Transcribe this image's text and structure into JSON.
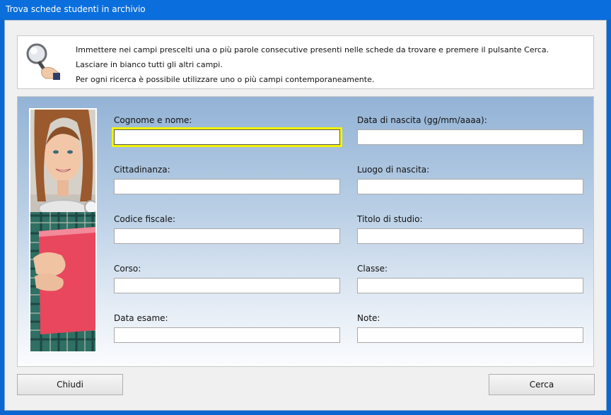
{
  "window": {
    "title": "Trova schede studenti in archivio"
  },
  "info": {
    "icon": "magnifier-icon",
    "lines": [
      "Immettere nei campi prescelti una o più parole consecutive presenti nelle schede da trovare e premere il pulsante Cerca.",
      "Lasciare in bianco tutti gli altri campi.",
      "Per ogni ricerca è possibile utilizzare uno o più campi contemporaneamente."
    ]
  },
  "form": {
    "fields": [
      {
        "label": "Cognome e nome:",
        "value": ""
      },
      {
        "label": "Data di nascita (gg/mm/aaaa):",
        "value": ""
      },
      {
        "label": "Cittadinanza:",
        "value": ""
      },
      {
        "label": "Luogo di nascita:",
        "value": ""
      },
      {
        "label": "Codice fiscale:",
        "value": ""
      },
      {
        "label": "Titolo di studio:",
        "value": ""
      },
      {
        "label": "Corso:",
        "value": ""
      },
      {
        "label": "Classe:",
        "value": ""
      },
      {
        "label": "Data esame:",
        "value": ""
      },
      {
        "label": "Note:",
        "value": ""
      }
    ],
    "focused_field": "Cognome e nome:"
  },
  "buttons": {
    "close": "Chiudi",
    "search": "Cerca"
  },
  "colors": {
    "titlebar": "#0a6fdd",
    "focus_highlight": "#f3f300",
    "panel_top": "#93b3d6"
  }
}
